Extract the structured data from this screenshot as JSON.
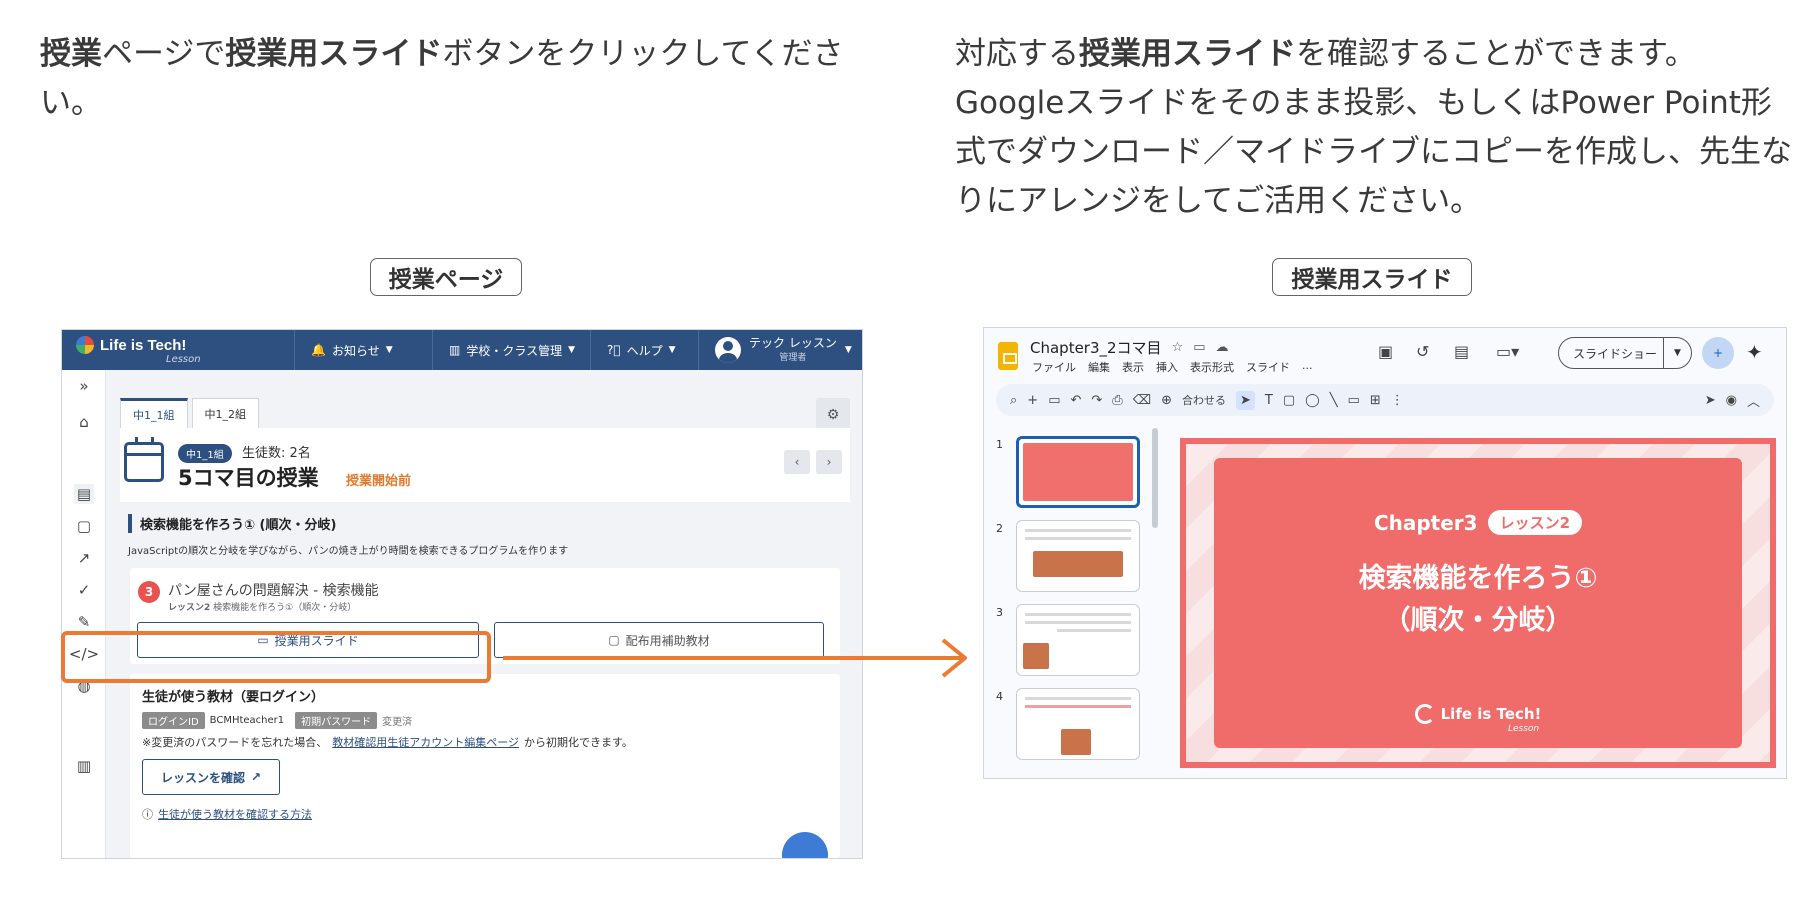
{
  "instructions": {
    "left": {
      "b1": "授業",
      "t1": "ページで",
      "b2": "授業用スライド",
      "t2": "ボタンをクリックしてください。"
    },
    "right": {
      "t1": "対応する",
      "b1": "授業用スライド",
      "t2": "を確認することができます。Googleスライドをそのまま投影、もしくはPower Point形式でダウンロード／マイドライブにコピーを作成し、先生なりにアレンジをしてご活用ください。"
    }
  },
  "captions": {
    "left": "授業ページ",
    "right": "授業用スライド"
  },
  "lesson_page": {
    "brand": "Life is Tech!",
    "brand_sub": "Lesson",
    "nav": {
      "notice": "お知らせ",
      "school": "学校・クラス管理",
      "help": "ヘルプ"
    },
    "user": {
      "name": "テック レッスン",
      "role": "管理者"
    },
    "tabs": [
      "中1_1組",
      "中1_2組"
    ],
    "class_badge": "中1_1組",
    "student_count": "生徒数: 2名",
    "lesson_title": "5コマ目の授業",
    "status": "授業開始前",
    "unit_title": "検索機能を作ろう① (順次・分岐)",
    "unit_desc": "JavaScriptの順次と分岐を学びながら、パンの焼き上がり時間を検索できるプログラムを作ります",
    "item": {
      "number": "3",
      "title": "パン屋さんの問題解決 - 検索機能",
      "sub_label": "レッスン2",
      "sub_text": "検索機能を作ろう①（順次・分岐）",
      "slide_button": "授業用スライド",
      "material_button": "配布用補助教材"
    },
    "student_material": {
      "title": "生徒が使う教材（要ログイン）",
      "login_id_label": "ログインID",
      "login_id": "BCMHteacher1",
      "password_label": "初期パスワード",
      "password_status": "変更済",
      "note_prefix": "※変更済のパスワードを忘れた場合、",
      "note_link": "教材確認用生徒アカウント編集ページ",
      "note_suffix": "から初期化できます。",
      "confirm_button": "レッスンを確認",
      "how_link": "生徒が使う教材を確認する方法"
    }
  },
  "slides_app": {
    "doc_title": "Chapter3_2コマ目",
    "menu": [
      "ファイル",
      "編集",
      "表示",
      "挿入",
      "表示形式",
      "スライド",
      "..."
    ],
    "present_button": "スライドショー",
    "toolbar_fit": "合わせる",
    "thumb_numbers": [
      "1",
      "2",
      "3",
      "4"
    ],
    "slide": {
      "chapter": "Chapter3",
      "lesson_pill": "レッスン2",
      "title_line1": "検索機能を作ろう①",
      "title_line2": "（順次・分岐）",
      "brand": "Life is Tech!",
      "brand_sub": "Lesson"
    }
  },
  "colors": {
    "navy": "#2d5080",
    "highlight_orange": "#ec7a35",
    "slide_red": "#f06c6a"
  }
}
